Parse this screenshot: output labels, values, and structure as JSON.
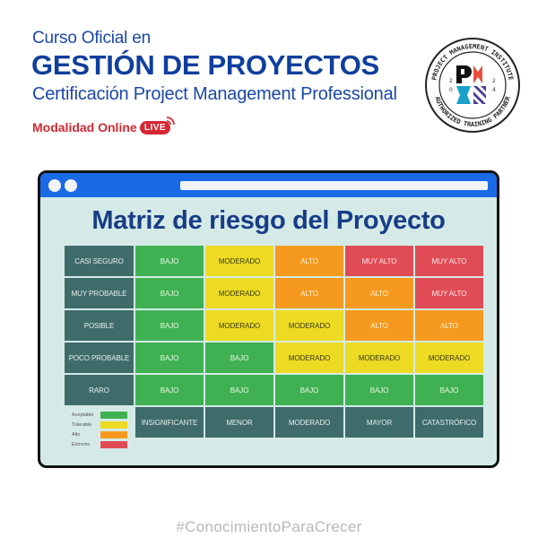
{
  "header": {
    "line1": "Curso Oficial en",
    "title": "GESTIÓN DE PROYECTOS",
    "subtitle": "Certificación Project Management Professional",
    "modalidad": "Modalidad Online",
    "live_label": "LIVE"
  },
  "badge": {
    "top_text": "PROJECT MANAGEMENT INSTITUTE",
    "bottom_text": "AUTHORIZED TRAINING PARTNER",
    "year_left": "20",
    "year_right": "24",
    "logo": "PMI"
  },
  "window": {
    "title": "Matriz de riesgo del Proyecto",
    "matrix": {
      "rows": [
        {
          "label": "CASI SEGURO",
          "cells": [
            "BAJO",
            "MODERADO",
            "ALTO",
            "MUY ALTO",
            "MUY ALTO"
          ]
        },
        {
          "label": "MUY PROBABLE",
          "cells": [
            "BAJO",
            "MODERADO",
            "ALTO",
            "ALTO",
            "MUY ALTO"
          ]
        },
        {
          "label": "POSIBLE",
          "cells": [
            "BAJO",
            "MODERADO",
            "MODERADO",
            "ALTO",
            "ALTO"
          ]
        },
        {
          "label": "POCO PROBABLE",
          "cells": [
            "BAJO",
            "BAJO",
            "MODERADO",
            "MODERADO",
            "MODERADO"
          ]
        },
        {
          "label": "RARO",
          "cells": [
            "BAJO",
            "BAJO",
            "BAJO",
            "BAJO",
            "BAJO"
          ]
        }
      ],
      "columns": [
        "INSIGNIFICANTE",
        "MENOR",
        "MODERADO",
        "MAYOR",
        "CATASTRÓFICO"
      ],
      "level_colors": {
        "BAJO": "#3fb152",
        "MODERADO": "#ecdb22",
        "ALTO": "#f59a1e",
        "MUY ALTO": "#e04c55"
      }
    },
    "legend": [
      {
        "label": "Aceptable",
        "color": "#3fb152"
      },
      {
        "label": "Tolerable",
        "color": "#ecdb22"
      },
      {
        "label": "Alto",
        "color": "#f59a1e"
      },
      {
        "label": "Extremo",
        "color": "#e04c55"
      }
    ]
  },
  "footer": {
    "hashtag": "#ConocimientoParaCrecer"
  }
}
